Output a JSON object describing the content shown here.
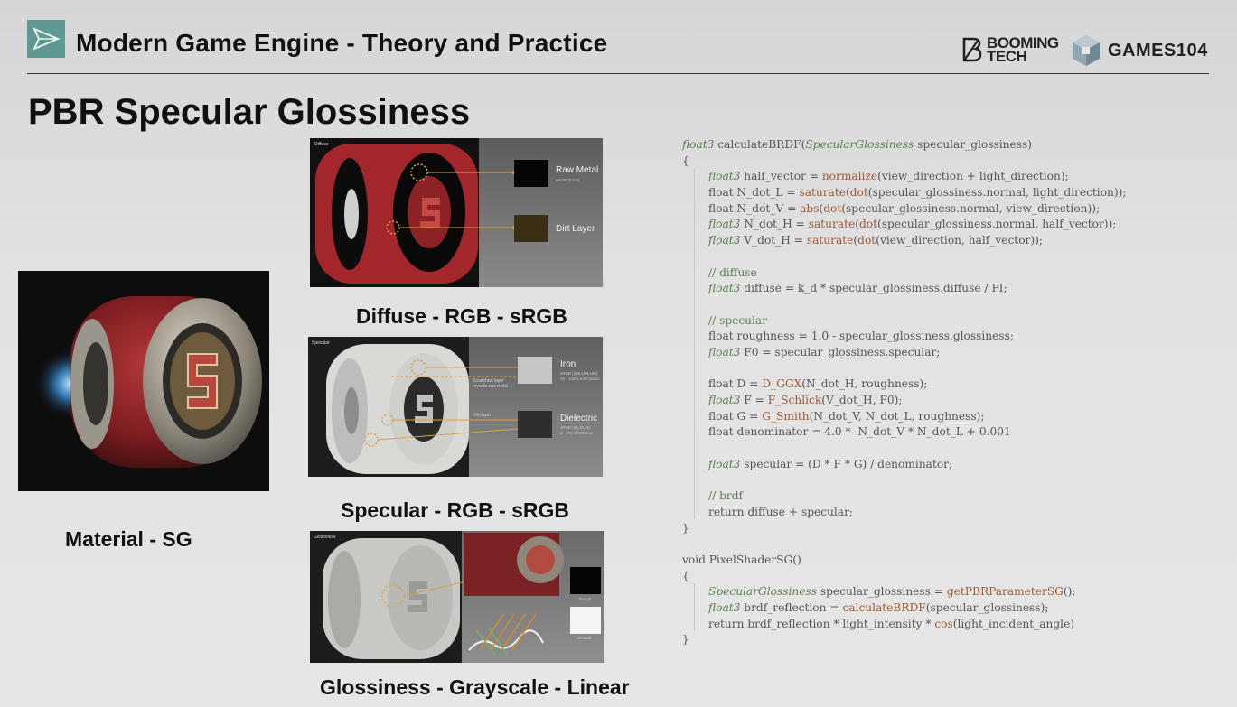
{
  "header": {
    "deck_title": "Modern Game Engine - Theory and Practice",
    "brand_booming_line1": "BOOMING",
    "brand_booming_line2": "TECH",
    "brand_games": "GAMES104"
  },
  "slide": {
    "title": "PBR Specular Glossiness"
  },
  "figures": {
    "material": {
      "caption": "Material - SG"
    },
    "diffuse": {
      "caption": "Diffuse - RGB - sRGB",
      "panel_label": "Diffuse",
      "swatches": [
        {
          "label": "Raw Metal",
          "sub": "sRGB (0,0,0)",
          "color": "#050505"
        },
        {
          "label": "Dirt Layer",
          "sub": "",
          "color": "#3a2f14"
        }
      ]
    },
    "specular": {
      "caption": "Specular - RGB - sRGB",
      "panel_label": "Specular",
      "note_scratch": "Scratched layer reveals raw metal",
      "note_dirt": "Dirt layer",
      "swatches": [
        {
          "label": "Iron",
          "sub1": "sRGB (196,199,199)",
          "sub2": "70 - 100% reflectance",
          "color": "#c6c7c7"
        },
        {
          "label": "Dielectric",
          "sub1": "sRGB (35,35,35)",
          "sub2": "2 - 8% reflectance",
          "color": "#2e2e2e"
        }
      ]
    },
    "glossiness": {
      "caption": "Glossiness - Grayscale - Linear",
      "panel_label": "Glossiness",
      "swatches": [
        {
          "label": "Rough",
          "color": "#050505"
        },
        {
          "label": "Smooth",
          "color": "#f4f4f4"
        }
      ]
    }
  },
  "code": {
    "lines": [
      [
        {
          "t": "float3",
          "c": "type"
        },
        {
          "t": " calculateBRDF(",
          "c": ""
        },
        {
          "t": "SpecularGlossiness",
          "c": "type"
        },
        {
          "t": " specular_glossiness)",
          "c": ""
        }
      ],
      [
        {
          "t": "{",
          "c": ""
        }
      ],
      [
        {
          "t": "float3",
          "c": "type"
        },
        {
          "t": " half_vector = ",
          "c": ""
        },
        {
          "t": "normalize",
          "c": "fn"
        },
        {
          "t": "(view_direction + light_direction);",
          "c": ""
        }
      ],
      [
        {
          "t": "float N_dot_L = ",
          "c": ""
        },
        {
          "t": "saturate",
          "c": "fn"
        },
        {
          "t": "(",
          "c": ""
        },
        {
          "t": "dot",
          "c": "fn"
        },
        {
          "t": "(specular_glossiness.normal, light_direction));",
          "c": ""
        }
      ],
      [
        {
          "t": "float N_dot_V = ",
          "c": ""
        },
        {
          "t": "abs",
          "c": "fn"
        },
        {
          "t": "(",
          "c": ""
        },
        {
          "t": "dot",
          "c": "fn"
        },
        {
          "t": "(specular_glossiness.normal, view_direction));",
          "c": ""
        }
      ],
      [
        {
          "t": "float3",
          "c": "type"
        },
        {
          "t": " N_dot_H = ",
          "c": ""
        },
        {
          "t": "saturate",
          "c": "fn"
        },
        {
          "t": "(",
          "c": ""
        },
        {
          "t": "dot",
          "c": "fn"
        },
        {
          "t": "(specular_glossiness.normal, half_vector));",
          "c": ""
        }
      ],
      [
        {
          "t": "float3",
          "c": "type"
        },
        {
          "t": " V_dot_H = ",
          "c": ""
        },
        {
          "t": "saturate",
          "c": "fn"
        },
        {
          "t": "(",
          "c": ""
        },
        {
          "t": "dot",
          "c": "fn"
        },
        {
          "t": "(view_direction, half_vector));",
          "c": ""
        }
      ],
      [],
      [
        {
          "t": "// diffuse",
          "c": "cm"
        }
      ],
      [
        {
          "t": "float3",
          "c": "type"
        },
        {
          "t": " diffuse = k_d * specular_glossiness.diffuse / PI;",
          "c": ""
        }
      ],
      [],
      [
        {
          "t": "// specular",
          "c": "cm"
        }
      ],
      [
        {
          "t": "float roughness = 1.0 - specular_glossiness.glossiness;",
          "c": ""
        }
      ],
      [
        {
          "t": "float3",
          "c": "type"
        },
        {
          "t": " F0 = specular_glossiness.specular;",
          "c": ""
        }
      ],
      [],
      [
        {
          "t": "float D = ",
          "c": ""
        },
        {
          "t": "D_GGX",
          "c": "fn"
        },
        {
          "t": "(N_dot_H, roughness);",
          "c": ""
        }
      ],
      [
        {
          "t": "float3",
          "c": "type"
        },
        {
          "t": " F = ",
          "c": ""
        },
        {
          "t": "F_Schlick",
          "c": "fn"
        },
        {
          "t": "(V_dot_H, F0);",
          "c": ""
        }
      ],
      [
        {
          "t": "float G = ",
          "c": ""
        },
        {
          "t": "G_Smith",
          "c": "fn"
        },
        {
          "t": "(N_dot_V, N_dot_L, roughness);",
          "c": ""
        }
      ],
      [
        {
          "t": "float denominator = 4.0 *  N_dot_V * N_dot_L + 0.001",
          "c": ""
        }
      ],
      [],
      [
        {
          "t": "float3",
          "c": "type"
        },
        {
          "t": " specular = (D * F * G) / denominator;",
          "c": ""
        }
      ],
      [],
      [
        {
          "t": "// brdf",
          "c": "cm"
        }
      ],
      [
        {
          "t": "return diffuse + specular;",
          "c": ""
        }
      ],
      [
        {
          "t": "}",
          "c": ""
        }
      ],
      [],
      [
        {
          "t": "void PixelShaderSG()",
          "c": ""
        }
      ],
      [
        {
          "t": "{",
          "c": ""
        }
      ],
      [
        {
          "t": "SpecularGlossiness",
          "c": "type"
        },
        {
          "t": " specular_glossiness = ",
          "c": ""
        },
        {
          "t": "getPBRParameterSG",
          "c": "fn"
        },
        {
          "t": "();",
          "c": ""
        }
      ],
      [
        {
          "t": "float3",
          "c": "type"
        },
        {
          "t": " brdf_reflection = ",
          "c": ""
        },
        {
          "t": "calculateBRDF",
          "c": "fn"
        },
        {
          "t": "(specular_glossiness);",
          "c": ""
        }
      ],
      [
        {
          "t": "return brdf_reflection * light_intensity * ",
          "c": ""
        },
        {
          "t": "cos",
          "c": "fn"
        },
        {
          "t": "(light_incident_angle)",
          "c": ""
        }
      ],
      [
        {
          "t": "}",
          "c": ""
        }
      ]
    ],
    "indented": [
      2,
      3,
      4,
      5,
      6,
      8,
      9,
      11,
      12,
      13,
      15,
      16,
      17,
      18,
      20,
      22,
      23,
      28,
      29,
      30
    ]
  }
}
